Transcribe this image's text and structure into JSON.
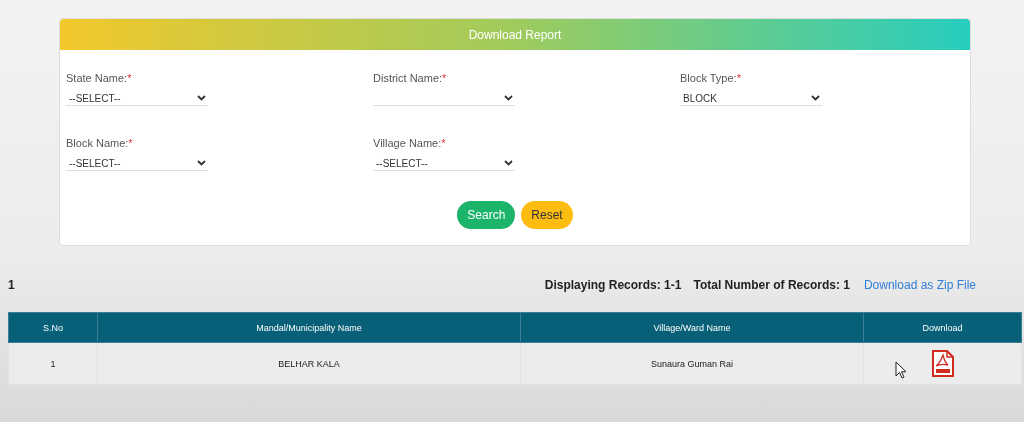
{
  "form": {
    "title": "Download Report",
    "fields": [
      {
        "label": "State Name:",
        "required_mark": "*",
        "value": "--SELECT--"
      },
      {
        "label": "District Name:",
        "required_mark": "*"
      },
      {
        "label": "Block Type:",
        "required_mark": "*",
        "value": "BLOCK"
      },
      {
        "label": "Block Name:",
        "required_mark": "*",
        "value": "--SELECT--"
      },
      {
        "label": "Village Name:",
        "required_mark": "*",
        "value": "--SELECT--"
      }
    ],
    "buttons": [
      {
        "label": "Search",
        "kind": "primary"
      },
      {
        "label": "Reset",
        "kind": "warning"
      }
    ]
  },
  "results": {
    "page": "1",
    "displaying": "Displaying Records: 1-1",
    "total": "Total Number of Records: 1",
    "zip_link": "Download as Zip File"
  },
  "table": {
    "columns": [
      "S.No",
      "Mandal/Municipality Name",
      "Village/Ward Name",
      "Download"
    ],
    "rows": [
      {
        "cells": [
          "1",
          "BELHAR KALA",
          "Sunaura Guman Rai"
        ]
      }
    ]
  }
}
